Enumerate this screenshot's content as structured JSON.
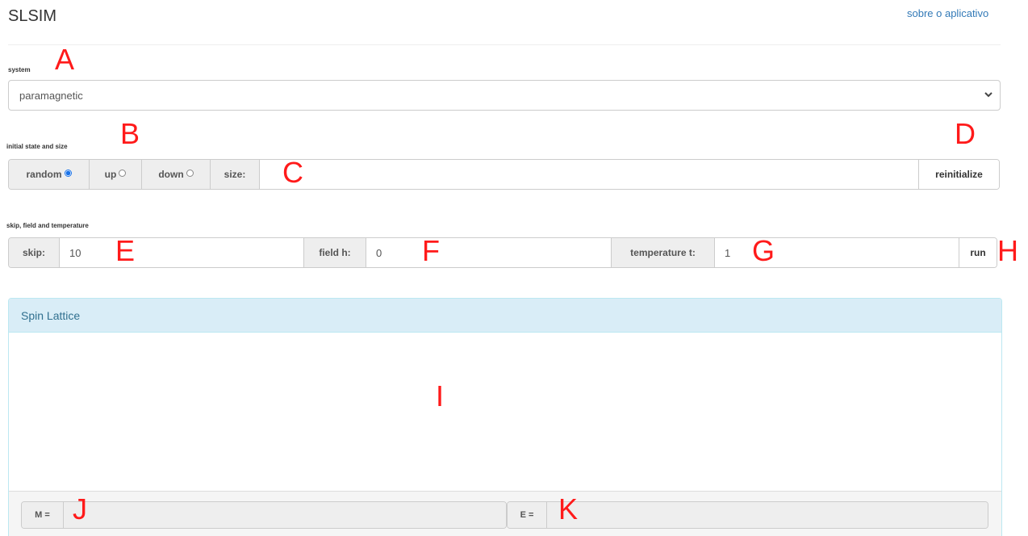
{
  "header": {
    "title": "SLSIM",
    "about_link": "sobre o aplicativo"
  },
  "system": {
    "label": "system",
    "selected": "paramagnetic",
    "marker": "A"
  },
  "initial": {
    "label": "initial state and size",
    "random_label": "random",
    "up_label": "up",
    "down_label": "down",
    "selected": "random",
    "size_label": "size:",
    "size_value": "",
    "reinitialize_label": "reinitialize",
    "marker_b": "B",
    "marker_c": "C",
    "marker_d": "D"
  },
  "params": {
    "label": "skip, field and temperature",
    "skip_label": "skip:",
    "skip_value": "10",
    "field_label": "field h:",
    "field_value": "0",
    "temp_label": "temperature t:",
    "temp_value": "1",
    "run_label": "run",
    "marker_e": "E",
    "marker_f": "F",
    "marker_g": "G",
    "marker_h": "H"
  },
  "lattice": {
    "title": "Spin Lattice",
    "marker_i": "I",
    "m_label": "M =",
    "m_value": "",
    "e_label": "E =",
    "e_value": "",
    "marker_j": "J",
    "marker_k": "K"
  },
  "colors": {
    "accent": "#337ab7",
    "panel_heading": "#d9edf7",
    "marker": "#ff1a1a"
  },
  "icons": {
    "select_arrow": "chevron-down-icon"
  }
}
